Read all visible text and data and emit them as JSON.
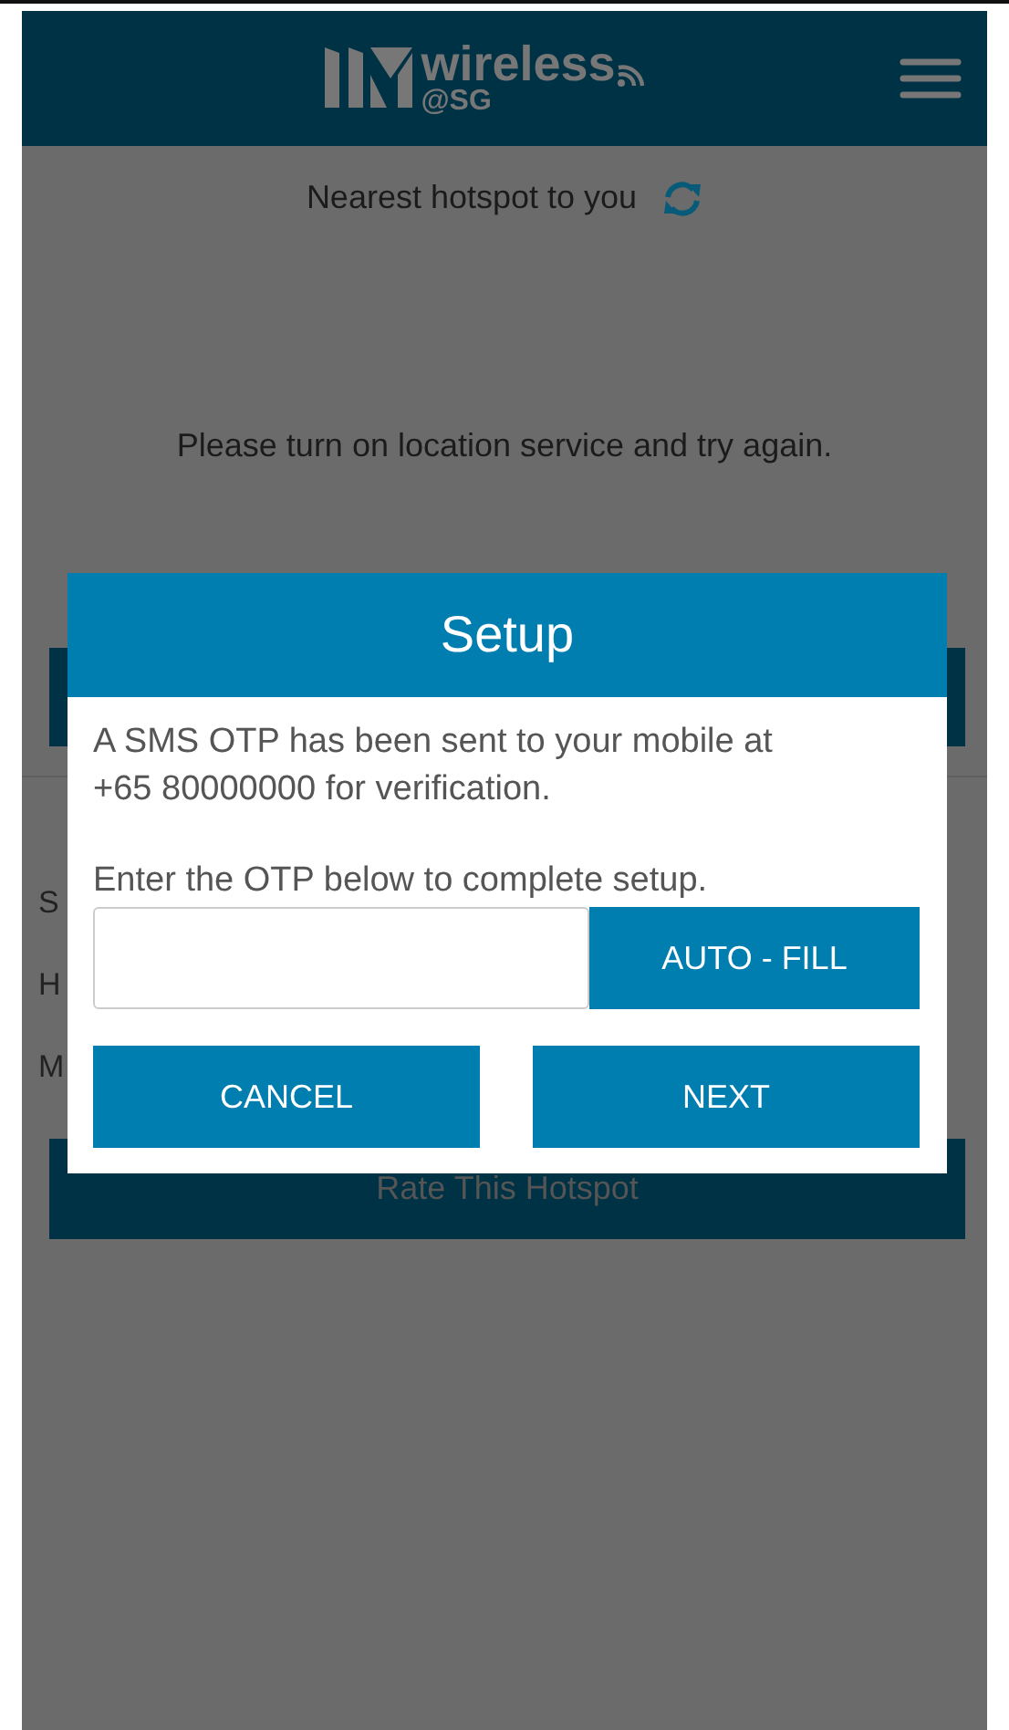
{
  "header": {
    "logo_text": "wireless",
    "logo_subtext": "@SG"
  },
  "nearest": {
    "label": "Nearest hotspot to you"
  },
  "message": "Please turn on location service and try again.",
  "details": [
    {
      "label": "S"
    },
    {
      "label": "H"
    },
    {
      "label": "M"
    }
  ],
  "rate_button": "Rate This Hotspot",
  "dialog": {
    "title": "Setup",
    "message_lines": [
      "A SMS OTP has been sent to your mobile at",
      "+65 80000000 for verification."
    ],
    "instruction": "Enter the OTP below to complete setup.",
    "autofill_button": "AUTO - FILL",
    "buttons": [
      "CANCEL",
      "NEXT"
    ]
  }
}
